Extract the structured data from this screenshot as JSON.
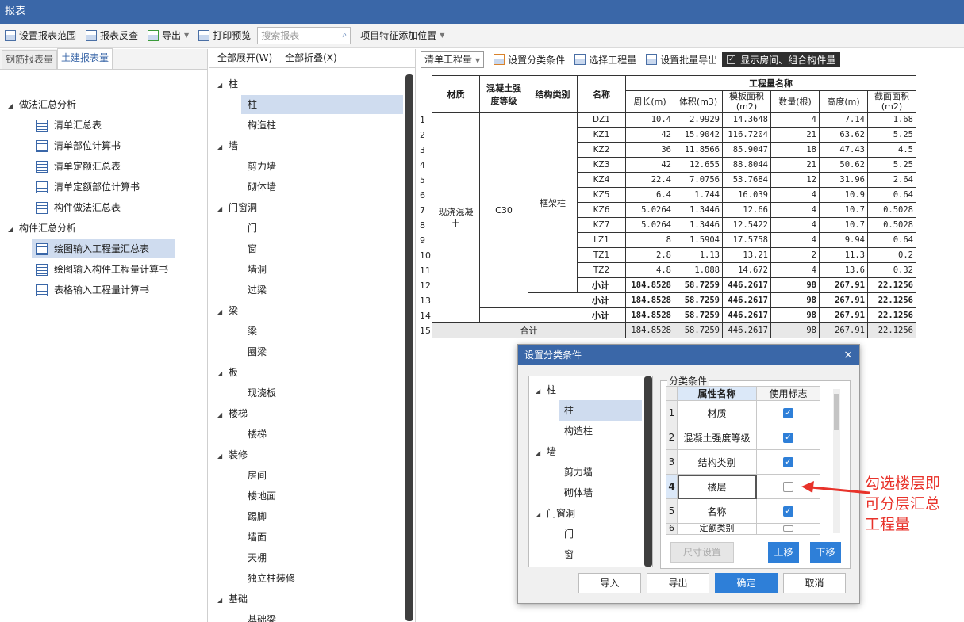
{
  "window": {
    "title": "报表"
  },
  "toolbar": {
    "set_range": "设置报表范围",
    "report_reverse": "报表反查",
    "export": "导出",
    "print_preview": "打印预览",
    "search_placeholder": "搜索报表",
    "feature_position": "项目特征添加位置"
  },
  "left_panel": {
    "tabs": [
      "钢筋报表量",
      "土建报表量"
    ],
    "groups": [
      {
        "label": "做法汇总分析",
        "items": [
          "清单汇总表",
          "清单部位计算书",
          "清单定额汇总表",
          "清单定额部位计算书",
          "构件做法汇总表"
        ]
      },
      {
        "label": "构件汇总分析",
        "items": [
          "绘图输入工程量汇总表",
          "绘图输入构件工程量计算书",
          "表格输入工程量计算书"
        ]
      }
    ]
  },
  "middle_panel": {
    "expand_all": "全部展开(W)",
    "collapse_all": "全部折叠(X)",
    "tree": [
      {
        "label": "柱",
        "children": [
          "柱",
          "构造柱"
        ]
      },
      {
        "label": "墙",
        "children": [
          "剪力墙",
          "砌体墙"
        ]
      },
      {
        "label": "门窗洞",
        "children": [
          "门",
          "窗",
          "墙洞",
          "过梁"
        ]
      },
      {
        "label": "梁",
        "children": [
          "梁",
          "圈梁"
        ]
      },
      {
        "label": "板",
        "children": [
          "现浇板"
        ]
      },
      {
        "label": "楼梯",
        "children": [
          "楼梯"
        ]
      },
      {
        "label": "装修",
        "children": [
          "房间",
          "楼地面",
          "踢脚",
          "墙面",
          "天棚",
          "独立柱装修"
        ]
      },
      {
        "label": "基础",
        "children": [
          "基础梁"
        ]
      }
    ]
  },
  "right_toolbar": {
    "combo": "清单工程量",
    "set_category": "设置分类条件",
    "select_quantity": "选择工程量",
    "batch_export": "设置批量导出",
    "show_room": "显示房间、组合构件量"
  },
  "grid": {
    "headers": {
      "material": "材质",
      "concrete_grade": "混凝土强度等级",
      "struct_type": "结构类别",
      "name": "名称",
      "group": "工程量名称"
    },
    "sub_headers": [
      "周长(m)",
      "体积(m3)",
      "模板面积(m2)",
      "数量(根)",
      "高度(m)",
      "截面面积(m2)"
    ],
    "material_value": "现浇混凝土",
    "grade_value": "C30",
    "struct_value": "框架柱",
    "rows": [
      {
        "n": "1",
        "name": "DZ1",
        "v": [
          "10.4",
          "2.9929",
          "14.3648",
          "4",
          "7.14",
          "1.68"
        ]
      },
      {
        "n": "2",
        "name": "KZ1",
        "v": [
          "42",
          "15.9042",
          "116.7204",
          "21",
          "63.62",
          "5.25"
        ]
      },
      {
        "n": "3",
        "name": "KZ2",
        "v": [
          "36",
          "11.8566",
          "85.9047",
          "18",
          "47.43",
          "4.5"
        ]
      },
      {
        "n": "4",
        "name": "KZ3",
        "v": [
          "42",
          "12.655",
          "88.8044",
          "21",
          "50.62",
          "5.25"
        ]
      },
      {
        "n": "5",
        "name": "KZ4",
        "v": [
          "22.4",
          "7.0756",
          "53.7684",
          "12",
          "31.96",
          "2.64"
        ]
      },
      {
        "n": "6",
        "name": "KZ5",
        "v": [
          "6.4",
          "1.744",
          "16.039",
          "4",
          "10.9",
          "0.64"
        ]
      },
      {
        "n": "7",
        "name": "KZ6",
        "v": [
          "5.0264",
          "1.3446",
          "12.66",
          "4",
          "10.7",
          "0.5028"
        ]
      },
      {
        "n": "8",
        "name": "KZ7",
        "v": [
          "5.0264",
          "1.3446",
          "12.5422",
          "4",
          "10.7",
          "0.5028"
        ]
      },
      {
        "n": "9",
        "name": "LZ1",
        "v": [
          "8",
          "1.5904",
          "17.5758",
          "4",
          "9.94",
          "0.64"
        ]
      },
      {
        "n": "10",
        "name": "TZ1",
        "v": [
          "2.8",
          "1.13",
          "13.21",
          "2",
          "11.3",
          "0.2"
        ]
      },
      {
        "n": "11",
        "name": "TZ2",
        "v": [
          "4.8",
          "1.088",
          "14.672",
          "4",
          "13.6",
          "0.32"
        ]
      }
    ],
    "subtotal_label": "小计",
    "subtotals": [
      {
        "n": "12",
        "v": [
          "184.8528",
          "58.7259",
          "446.2617",
          "98",
          "267.91",
          "22.1256"
        ]
      },
      {
        "n": "13",
        "v": [
          "184.8528",
          "58.7259",
          "446.2617",
          "98",
          "267.91",
          "22.1256"
        ]
      },
      {
        "n": "14",
        "v": [
          "184.8528",
          "58.7259",
          "446.2617",
          "98",
          "267.91",
          "22.1256"
        ]
      }
    ],
    "total_label": "合计",
    "total": {
      "n": "15",
      "v": [
        "184.8528",
        "58.7259",
        "446.2617",
        "98",
        "267.91",
        "22.1256"
      ]
    }
  },
  "dialog": {
    "title": "设置分类条件",
    "close": "×",
    "tree": [
      {
        "label": "柱",
        "children": [
          "柱",
          "构造柱"
        ]
      },
      {
        "label": "墙",
        "children": [
          "剪力墙",
          "砌体墙"
        ]
      },
      {
        "label": "门窗洞",
        "children": [
          "门",
          "窗"
        ]
      }
    ],
    "legend": "分类条件",
    "col_name": "属性名称",
    "col_flag": "使用标志",
    "props": [
      {
        "n": "1",
        "name": "材质",
        "checked": true
      },
      {
        "n": "2",
        "name": "混凝土强度等级",
        "checked": true
      },
      {
        "n": "3",
        "name": "结构类别",
        "checked": true
      },
      {
        "n": "4",
        "name": "楼层",
        "checked": false
      },
      {
        "n": "5",
        "name": "名称",
        "checked": true
      },
      {
        "n": "6",
        "name": "定额类别",
        "checked": false
      }
    ],
    "btn_size": "尺寸设置",
    "btn_up": "上移",
    "btn_down": "下移",
    "btn_import": "导入",
    "btn_export": "导出",
    "btn_ok": "确定",
    "btn_cancel": "取消"
  },
  "annotation": {
    "lines": [
      "勾选楼层即",
      "可分层汇总",
      "工程量"
    ],
    "color": "#e8322a"
  }
}
